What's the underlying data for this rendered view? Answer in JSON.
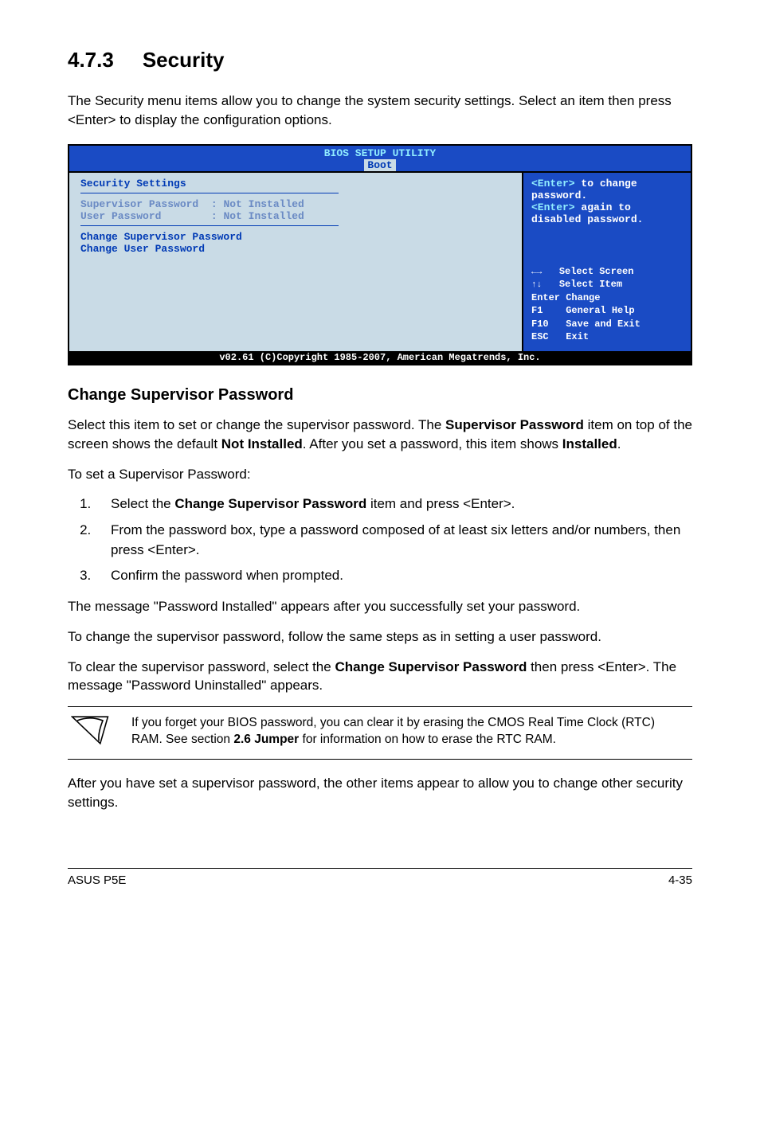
{
  "section": {
    "num": "4.7.3",
    "title": "Security"
  },
  "intro": "The Security menu items allow you to change the system security settings. Select an item then press <Enter> to display the configuration options.",
  "bios": {
    "title": "BIOS SETUP UTILITY",
    "tab": "Boot",
    "leftTitle": "Security Settings",
    "supLabel": "Supervisor Password",
    "supVal": ": Not Installed",
    "userLabel": "User Password",
    "userVal": ": Not Installed",
    "cmd1": "Change Supervisor Password",
    "cmd2": "Change User Password",
    "helpLine1a": "<Enter>",
    "helpLine1b": " to change password.",
    "helpLine2a": "<Enter>",
    "helpLine2b": " again to disabled password.",
    "k1": "Select Screen",
    "k2": "Select Item",
    "k3lbl": "Enter",
    "k3": "Change",
    "k4lbl": "F1",
    "k4": "General Help",
    "k5lbl": "F10",
    "k5": "Save and Exit",
    "k6lbl": "ESC",
    "k6": "Exit",
    "footer": "v02.61 (C)Copyright 1985-2007, American Megatrends, Inc."
  },
  "headings": {
    "csp": "Change Supervisor Password"
  },
  "para1a": "Select this item to set or change the supervisor password. The ",
  "para1b": "Supervisor Password",
  "para1c": " item on top of the screen shows the default ",
  "para1d": "Not Installed",
  "para1e": ". After you set a password, this item shows ",
  "para1f": "Installed",
  "para1g": ".",
  "para2": "To set a Supervisor Password:",
  "step1a": "Select the ",
  "step1b": "Change Supervisor Password",
  "step1c": " item and press <Enter>.",
  "step2": "From the password box, type a password composed of at least six letters and/or numbers, then press <Enter>.",
  "step3": "Confirm the password when prompted.",
  "para3": "The message \"Password Installed\" appears after you successfully set your password.",
  "para4": "To change the supervisor password, follow the same steps as in setting a user password.",
  "para5a": "To clear the supervisor password, select the ",
  "para5b": "Change Supervisor Password",
  "para5c": " then press <Enter>. The message \"Password Uninstalled\" appears.",
  "noteA": "If you forget your BIOS password, you can clear it by erasing the CMOS Real Time Clock (RTC) RAM. See section ",
  "noteB": "2.6 Jumper",
  "noteC": " for information on how to erase the RTC RAM.",
  "para6": "After you have set a supervisor password, the other items appear to allow you to change other security settings.",
  "footerLeft": "ASUS P5E",
  "footerRight": "4-35"
}
